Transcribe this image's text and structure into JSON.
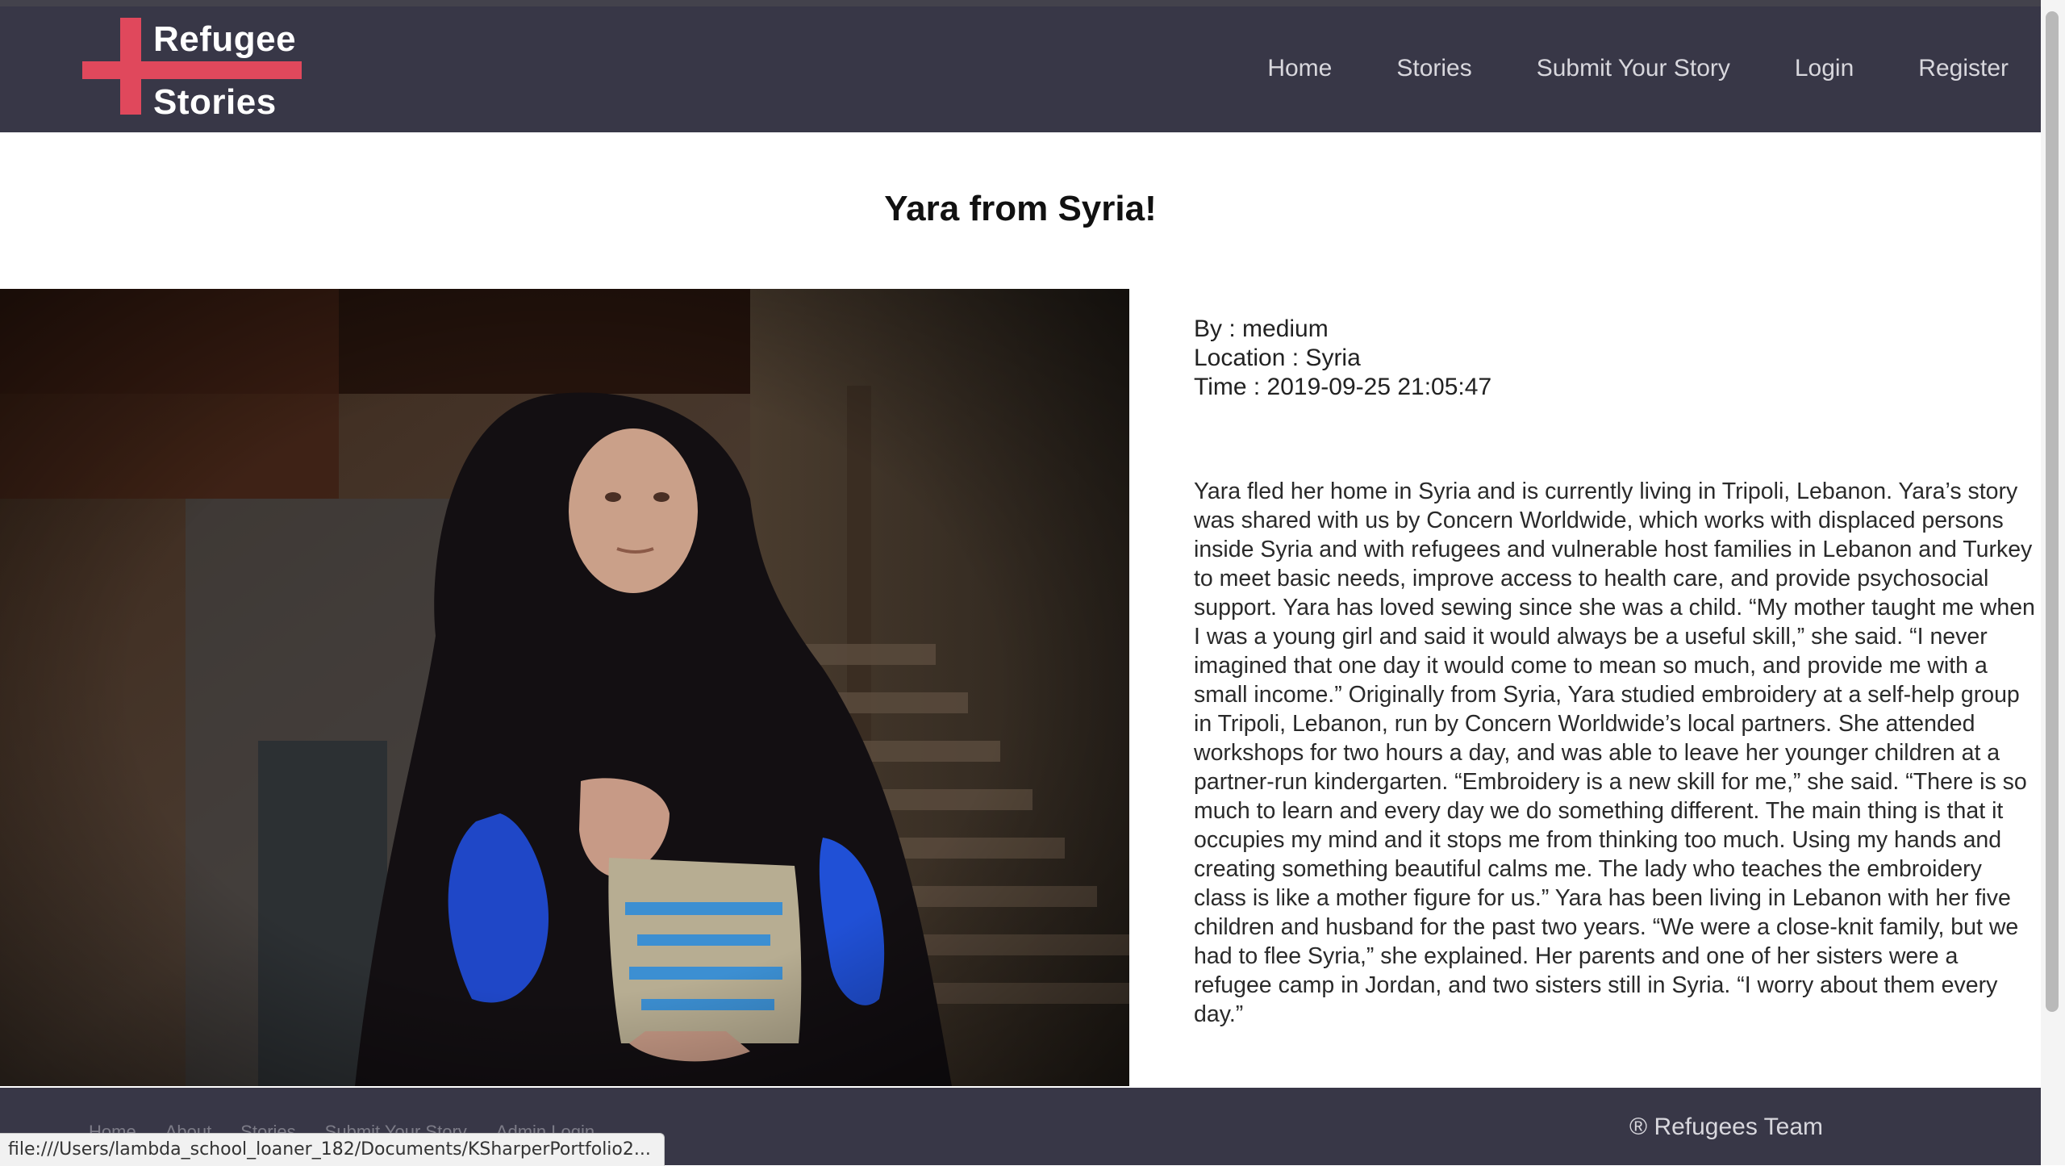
{
  "logo": {
    "line1": "Refugee",
    "line2": "Stories"
  },
  "nav": {
    "items": [
      "Home",
      "Stories",
      "Submit Your Story",
      "Login",
      "Register"
    ]
  },
  "story": {
    "title": "Yara from Syria!",
    "by": "By : medium",
    "location": "Location : Syria",
    "time": "Time : 2019-09-25 21:05:47",
    "body": "Yara fled her home in Syria and is currently living in Tripoli, Lebanon. Yara’s story was shared with us by Concern Worldwide, which works with displaced persons inside Syria and with refugees and vulnerable host families in Lebanon and Turkey to meet basic needs, improve access to health care, and provide psychosocial support. Yara has loved sewing since she was a child. “My mother taught me when I was a young girl and said it would always be a useful skill,” she said. “I never imagined that one day it would come to mean so much, and provide me with a small income.” Originally from Syria, Yara studied embroidery at a self-help group in Tripoli, Lebanon, run by Concern Worldwide’s local partners. She attended workshops for two hours a day, and was able to leave her younger children at a partner-run kindergarten. “Embroidery is a new skill for me,” she said. “There is so much to learn and every day we do something different. The main thing is that it occupies my mind and it stops me from thinking too much. Using my hands and creating something beautiful calms me. The lady who teaches the embroidery class is like a mother figure for us.” Yara has been living in Lebanon with her five children and husband for the past two years. “We were a close-knit family, but we had to flee Syria,” she explained. Her parents and one of her sisters were a refugee camp in Jordan, and two sisters still in Syria. “I worry about them every day.”"
  },
  "footer": {
    "links": [
      "Home",
      "About",
      "Stories",
      "Submit Your Story",
      "Admin Login"
    ],
    "copyright": "® Refugees Team"
  },
  "status_url": "file:///Users/lambda_school_loaner_182/Documents/KSharperPortfolio2...",
  "colors": {
    "navbar": "#383747",
    "accent": "#e0485c",
    "nav_text": "#d8d7dd"
  }
}
